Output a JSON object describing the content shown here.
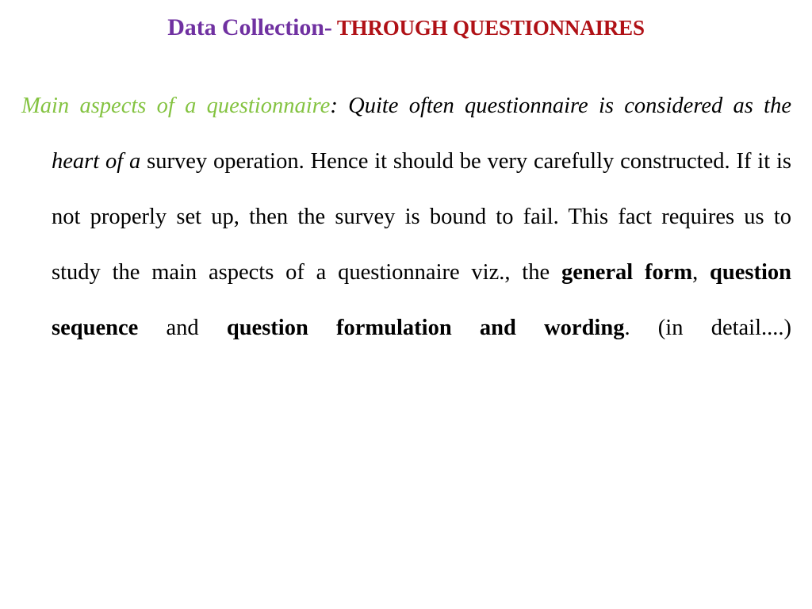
{
  "slide": {
    "background_color": "#ffffff",
    "title": {
      "main_text": "Data Collection-",
      "main_color": "#7031A1",
      "sub_text": " THROUGH QUESTIONNAIRES",
      "sub_color": "#B01116"
    },
    "body": {
      "runs": [
        {
          "text": "Main aspects of a questionnaire",
          "style": "green-italic",
          "color": "#84C341"
        },
        {
          "text": ": Quite often questionnaire is considered as the heart of a ",
          "style": "black-italic",
          "color": "#000000"
        },
        {
          "text": "survey operation. Hence it should be very carefully constructed. If it is not properly set up, then the survey is bound to fail. This fact requires us to study the main aspects of a questionnaire viz., the ",
          "style": "black-roman",
          "color": "#000000"
        },
        {
          "text": "general form",
          "style": "black-bold",
          "color": "#000000"
        },
        {
          "text": ", ",
          "style": "black-roman",
          "color": "#000000"
        },
        {
          "text": "question sequence",
          "style": "black-bold",
          "color": "#000000"
        },
        {
          "text": " and ",
          "style": "black-roman",
          "color": "#000000"
        },
        {
          "text": "question formulation and wording",
          "style": "black-bold",
          "color": "#000000"
        },
        {
          "text": ". (in detail....)",
          "style": "black-roman",
          "color": "#000000"
        }
      ]
    }
  }
}
